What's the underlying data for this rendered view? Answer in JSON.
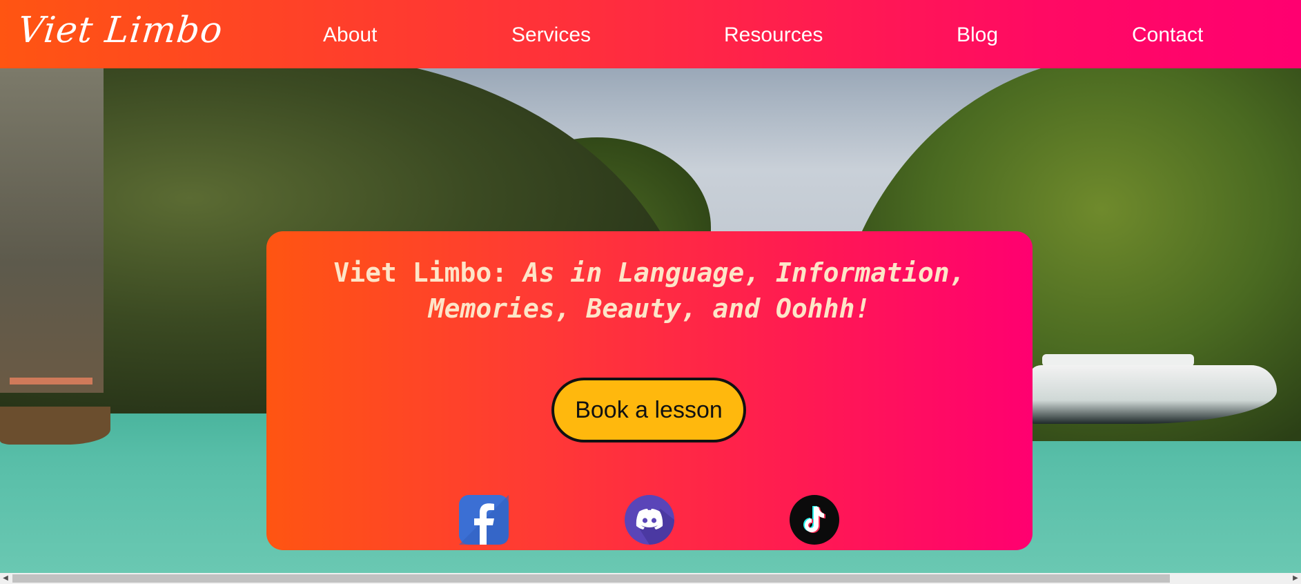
{
  "header": {
    "logo": "Viet Limbo",
    "nav": [
      "About",
      "Services",
      "Resources",
      "Blog",
      "Contact"
    ]
  },
  "hero": {
    "title_lead": "Viet Limbo: ",
    "title_emphasis": "As in Language, Information, Memories, Beauty, and Oohhh!",
    "cta_label": "Book a lesson",
    "social_icons": [
      "facebook-icon",
      "discord-icon",
      "tiktok-icon"
    ]
  },
  "colors": {
    "gradient_start": "#ff5512",
    "gradient_end": "#ff0070",
    "cta_background": "#ffb80d",
    "title_text": "#fde5c8"
  }
}
